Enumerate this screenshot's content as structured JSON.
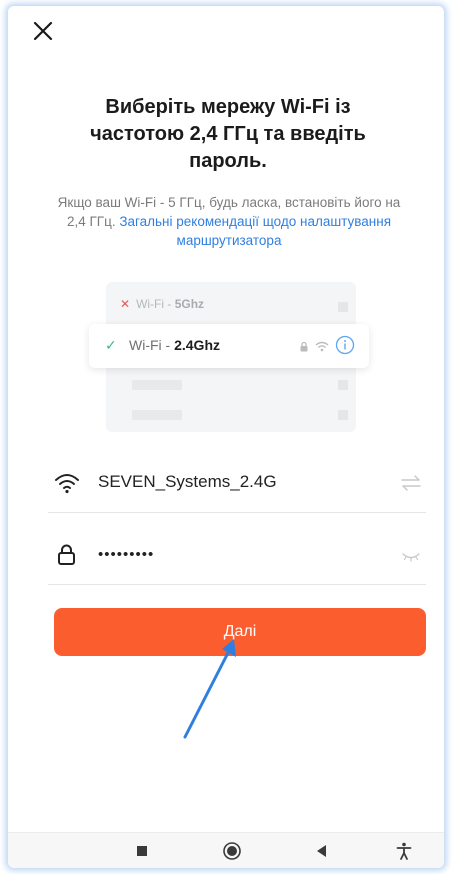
{
  "header": {
    "close_icon": "close-icon"
  },
  "title": "Виберіть мережу Wi-Fi із частотою 2,4 ГГц та введіть пароль.",
  "subtitle": {
    "text": "Якщо ваш Wi-Fi - 5 ГГц, будь ласка, встановіть його на 2,4 ГГц.",
    "link": "Загальні рекомендації щодо налаштування маршрутизатора"
  },
  "illustration": {
    "bad_prefix": "Wi-Fi - ",
    "bad_band": "5Ghz",
    "good_prefix": "Wi-Fi - ",
    "good_band": "2.4Ghz"
  },
  "wifi_field": {
    "icon": "wifi-icon",
    "value": "SEVEN_Systems_2.4G",
    "action_icon": "switch-network-icon"
  },
  "password_field": {
    "icon": "lock-icon",
    "value": "•••••••••",
    "action_icon": "eye-closed-icon"
  },
  "next_button": {
    "label": "Далі"
  },
  "colors": {
    "accent": "#fb5d2e",
    "link": "#2f7fe0",
    "success": "#3cb68c",
    "error": "#e85a5a"
  },
  "navbar": {
    "icons": [
      "recent-apps-icon",
      "home-icon",
      "back-icon",
      "accessibility-icon"
    ]
  }
}
